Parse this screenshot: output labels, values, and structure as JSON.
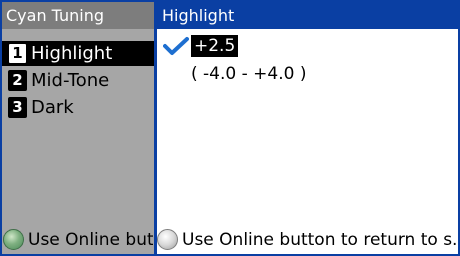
{
  "sidebar": {
    "title": "Cyan Tuning",
    "items": [
      {
        "number": "1",
        "label": "Highlight"
      },
      {
        "number": "2",
        "label": "Mid-Tone"
      },
      {
        "number": "3",
        "label": "Dark"
      }
    ],
    "hint": "Use Online button to return to s..."
  },
  "main": {
    "title": "Highlight",
    "selected_value": "+2.5",
    "range": "( -4.0 - +4.0 )",
    "hint": "Use Online button to return to s..."
  },
  "colors": {
    "accent": "#0a3fa3",
    "selection": "#000000",
    "check": "#1e6fd0"
  }
}
